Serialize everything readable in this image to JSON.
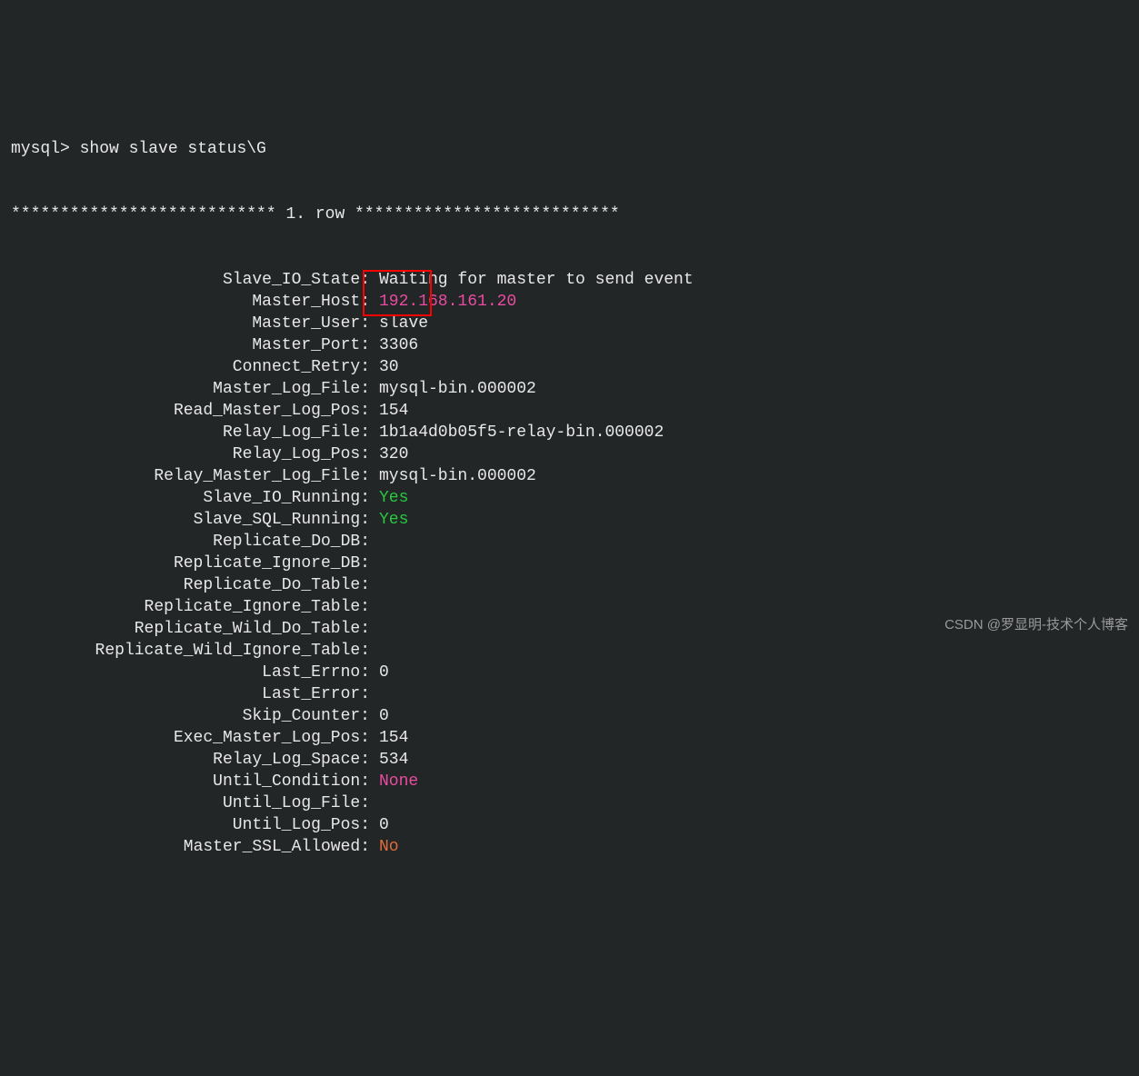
{
  "terminal": {
    "prompt": "mysql> show slave status\\G",
    "row_header": "*************************** 1. row ***************************",
    "fields": [
      {
        "label": "Slave_IO_State:",
        "value": "Waiting for master to send event",
        "class": ""
      },
      {
        "label": "Master_Host:",
        "value": "192.168.161.20",
        "class": "magenta"
      },
      {
        "label": "Master_User:",
        "value": "slave",
        "class": ""
      },
      {
        "label": "Master_Port:",
        "value": "3306",
        "class": ""
      },
      {
        "label": "Connect_Retry:",
        "value": "30",
        "class": ""
      },
      {
        "label": "Master_Log_File:",
        "value": "mysql-bin.000002",
        "class": ""
      },
      {
        "label": "Read_Master_Log_Pos:",
        "value": "154",
        "class": ""
      },
      {
        "label": "Relay_Log_File:",
        "value": "1b1a4d0b05f5-relay-bin.000002",
        "class": ""
      },
      {
        "label": "Relay_Log_Pos:",
        "value": "320",
        "class": ""
      },
      {
        "label": "Relay_Master_Log_File:",
        "value": "mysql-bin.000002",
        "class": ""
      },
      {
        "label": "Slave_IO_Running:",
        "value": "Yes",
        "class": "green"
      },
      {
        "label": "Slave_SQL_Running:",
        "value": "Yes",
        "class": "green"
      },
      {
        "label": "Replicate_Do_DB:",
        "value": "",
        "class": ""
      },
      {
        "label": "Replicate_Ignore_DB:",
        "value": "",
        "class": ""
      },
      {
        "label": "Replicate_Do_Table:",
        "value": "",
        "class": ""
      },
      {
        "label": "Replicate_Ignore_Table:",
        "value": "",
        "class": ""
      },
      {
        "label": "Replicate_Wild_Do_Table:",
        "value": "",
        "class": ""
      },
      {
        "label": "Replicate_Wild_Ignore_Table:",
        "value": "",
        "class": ""
      },
      {
        "label": "Last_Errno:",
        "value": "0",
        "class": ""
      },
      {
        "label": "Last_Error:",
        "value": "",
        "class": ""
      },
      {
        "label": "Skip_Counter:",
        "value": "0",
        "class": ""
      },
      {
        "label": "Exec_Master_Log_Pos:",
        "value": "154",
        "class": ""
      },
      {
        "label": "Relay_Log_Space:",
        "value": "534",
        "class": ""
      },
      {
        "label": "Until_Condition:",
        "value": "None",
        "class": "magenta"
      },
      {
        "label": "Until_Log_File:",
        "value": "",
        "class": ""
      },
      {
        "label": "Until_Log_Pos:",
        "value": "0",
        "class": ""
      },
      {
        "label": "Master_SSL_Allowed:",
        "value": "No",
        "class": "orange"
      }
    ]
  },
  "watermark": "CSDN @罗显明-技术个人博客"
}
